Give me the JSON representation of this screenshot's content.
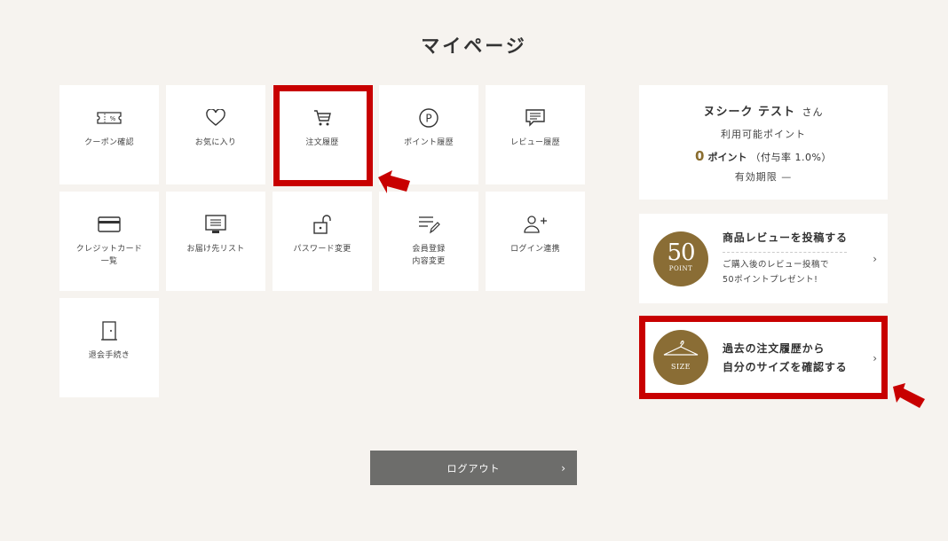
{
  "page": {
    "title": "マイページ"
  },
  "menu": [
    {
      "label": "クーポン確認",
      "icon": "coupon-icon"
    },
    {
      "label": "お気に入り",
      "icon": "heart-icon"
    },
    {
      "label": "注文履歴",
      "icon": "cart-icon"
    },
    {
      "label": "ポイント履歴",
      "icon": "point-icon"
    },
    {
      "label": "レビュー履歴",
      "icon": "review-icon"
    },
    {
      "label": "クレジットカード\n一覧",
      "icon": "credit-card-icon"
    },
    {
      "label": "お届け先リスト",
      "icon": "address-list-icon"
    },
    {
      "label": "パスワード変更",
      "icon": "unlock-icon"
    },
    {
      "label": "会員登録\n内容変更",
      "icon": "edit-list-icon"
    },
    {
      "label": "ログイン連携",
      "icon": "user-plus-icon"
    },
    {
      "label": "退会手続き",
      "icon": "door-icon"
    }
  ],
  "user": {
    "name": "ヌシーク テスト",
    "honorific": "さん",
    "points_label": "利用可能ポイント",
    "points_value": "0",
    "points_unit": "ポイント",
    "points_rate": "（付与率 1.0%）",
    "expire": "有効期限 —"
  },
  "review_promo": {
    "badge_number": "50",
    "badge_text": "POINT",
    "title": "商品レビューを投稿する",
    "line1": "ご購入後のレビュー投稿で",
    "line2": "50ポイントプレゼント!"
  },
  "size_promo": {
    "badge_text": "SIZE",
    "line1": "過去の注文履歴から",
    "line2": "自分のサイズを確認する"
  },
  "logout": {
    "label": "ログアウト"
  },
  "colors": {
    "accent": "#8a6d35",
    "highlight": "#c80000",
    "background": "#f6f3ef"
  }
}
